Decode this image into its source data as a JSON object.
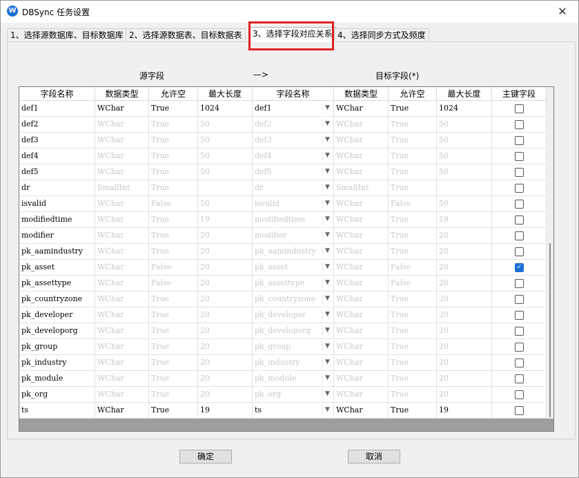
{
  "window": {
    "title": "DBSync 任务设置",
    "icon": "app-icon",
    "close_label": "✕"
  },
  "tabs": [
    {
      "label": "1、选择源数据库、目标数据库",
      "active": false
    },
    {
      "label": "2、选择源数据表、目标数据表",
      "active": false
    },
    {
      "label": "3、选择字段对应关系",
      "active": true
    },
    {
      "label": "4、选择同步方式及频度",
      "active": false
    }
  ],
  "mapping_header": {
    "source": "源字段",
    "arrow": "—>",
    "target": "目标字段(*)"
  },
  "columns": [
    "字段名称",
    "数据类型",
    "允许空",
    "最大长度",
    "字段名称",
    "数据类型",
    "允许空",
    "最大长度",
    "主键字段"
  ],
  "rows": [
    {
      "src_name": "def1",
      "src_type": "WChar",
      "src_null": "True",
      "src_len": "1024",
      "tgt_name": "def1",
      "tgt_type": "WChar",
      "tgt_null": "True",
      "tgt_len": "1024",
      "pk": false
    },
    {
      "src_name": "def2",
      "src_type": "WChar",
      "src_null": "True",
      "src_len": "50",
      "tgt_name": "def2",
      "tgt_type": "WChar",
      "tgt_null": "True",
      "tgt_len": "50",
      "pk": false
    },
    {
      "src_name": "def3",
      "src_type": "WChar",
      "src_null": "True",
      "src_len": "50",
      "tgt_name": "def3",
      "tgt_type": "WChar",
      "tgt_null": "True",
      "tgt_len": "50",
      "pk": false
    },
    {
      "src_name": "def4",
      "src_type": "WChar",
      "src_null": "True",
      "src_len": "50",
      "tgt_name": "def4",
      "tgt_type": "WChar",
      "tgt_null": "True",
      "tgt_len": "50",
      "pk": false
    },
    {
      "src_name": "def5",
      "src_type": "WChar",
      "src_null": "True",
      "src_len": "50",
      "tgt_name": "def5",
      "tgt_type": "WChar",
      "tgt_null": "True",
      "tgt_len": "50",
      "pk": false
    },
    {
      "src_name": "dr",
      "src_type": "SmallInt",
      "src_null": "True",
      "src_len": "",
      "tgt_name": "dr",
      "tgt_type": "SmallInt",
      "tgt_null": "True",
      "tgt_len": "",
      "pk": false
    },
    {
      "src_name": "isvalid",
      "src_type": "WChar",
      "src_null": "False",
      "src_len": "50",
      "tgt_name": "isvalid",
      "tgt_type": "WChar",
      "tgt_null": "False",
      "tgt_len": "50",
      "pk": false
    },
    {
      "src_name": "modifiedtime",
      "src_type": "WChar",
      "src_null": "True",
      "src_len": "19",
      "tgt_name": "modifiedtime",
      "tgt_type": "WChar",
      "tgt_null": "True",
      "tgt_len": "19",
      "pk": false
    },
    {
      "src_name": "modifier",
      "src_type": "WChar",
      "src_null": "True",
      "src_len": "20",
      "tgt_name": "modifier",
      "tgt_type": "WChar",
      "tgt_null": "True",
      "tgt_len": "20",
      "pk": false
    },
    {
      "src_name": "pk_aamindustry",
      "src_type": "WChar",
      "src_null": "True",
      "src_len": "20",
      "tgt_name": "pk_aamindustry",
      "tgt_type": "WChar",
      "tgt_null": "True",
      "tgt_len": "20",
      "pk": false
    },
    {
      "src_name": "pk_asset",
      "src_type": "WChar",
      "src_null": "False",
      "src_len": "20",
      "tgt_name": "pk_asset",
      "tgt_type": "WChar",
      "tgt_null": "False",
      "tgt_len": "20",
      "pk": true
    },
    {
      "src_name": "pk_assettype",
      "src_type": "WChar",
      "src_null": "False",
      "src_len": "20",
      "tgt_name": "pk_assettype",
      "tgt_type": "WChar",
      "tgt_null": "False",
      "tgt_len": "20",
      "pk": false
    },
    {
      "src_name": "pk_countryzone",
      "src_type": "WChar",
      "src_null": "True",
      "src_len": "20",
      "tgt_name": "pk_countryzone",
      "tgt_type": "WChar",
      "tgt_null": "True",
      "tgt_len": "20",
      "pk": false
    },
    {
      "src_name": "pk_developer",
      "src_type": "WChar",
      "src_null": "True",
      "src_len": "20",
      "tgt_name": "pk_developer",
      "tgt_type": "WChar",
      "tgt_null": "True",
      "tgt_len": "20",
      "pk": false
    },
    {
      "src_name": "pk_developorg",
      "src_type": "WChar",
      "src_null": "True",
      "src_len": "20",
      "tgt_name": "pk_developorg",
      "tgt_type": "WChar",
      "tgt_null": "True",
      "tgt_len": "20",
      "pk": false
    },
    {
      "src_name": "pk_group",
      "src_type": "WChar",
      "src_null": "True",
      "src_len": "20",
      "tgt_name": "pk_group",
      "tgt_type": "WChar",
      "tgt_null": "True",
      "tgt_len": "20",
      "pk": false
    },
    {
      "src_name": "pk_industry",
      "src_type": "WChar",
      "src_null": "True",
      "src_len": "20",
      "tgt_name": "pk_industry",
      "tgt_type": "WChar",
      "tgt_null": "True",
      "tgt_len": "20",
      "pk": false
    },
    {
      "src_name": "pk_module",
      "src_type": "WChar",
      "src_null": "True",
      "src_len": "20",
      "tgt_name": "pk_module",
      "tgt_type": "WChar",
      "tgt_null": "True",
      "tgt_len": "20",
      "pk": false
    },
    {
      "src_name": "pk_org",
      "src_type": "WChar",
      "src_null": "True",
      "src_len": "20",
      "tgt_name": "pk_org",
      "tgt_type": "WChar",
      "tgt_null": "True",
      "tgt_len": "20",
      "pk": false
    },
    {
      "src_name": "ts",
      "src_type": "WChar",
      "src_null": "True",
      "src_len": "19",
      "tgt_name": "ts",
      "tgt_type": "WChar",
      "tgt_null": "True",
      "tgt_len": "19",
      "pk": false
    }
  ],
  "buttons": {
    "ok": "确定",
    "cancel": "取消"
  },
  "colors": {
    "highlight": "#e02020",
    "checkbox_on": "#1a6fd6"
  }
}
